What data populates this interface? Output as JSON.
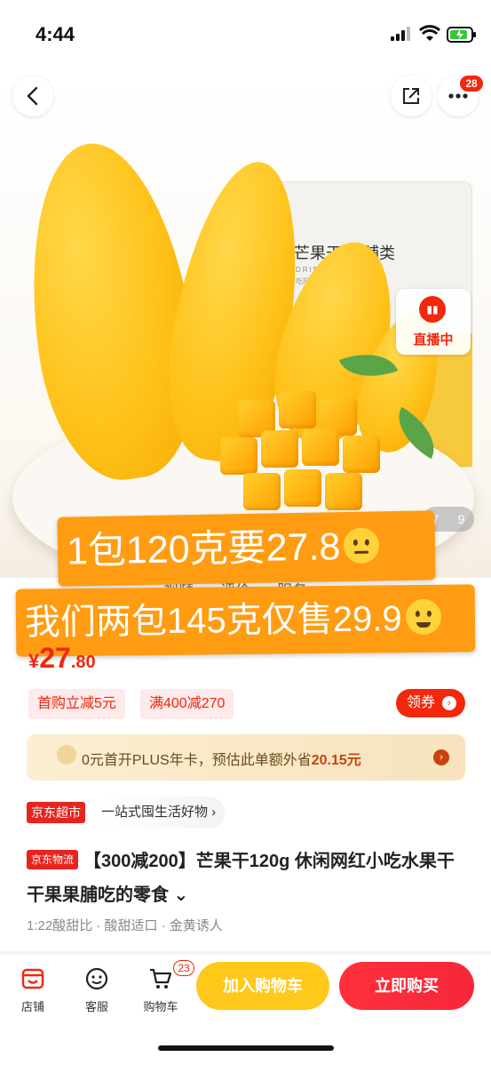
{
  "status_bar": {
    "time": "4:44"
  },
  "header": {
    "more_badge": "28"
  },
  "hero": {
    "package_title": "芒果干(果脯类",
    "package_sub": "DRIED MANGO",
    "package_line": "吃阳光长大的芒果干",
    "live_label": "直播中",
    "page_current": "7",
    "page_total": "9"
  },
  "overlay": {
    "line1": "1包120克要27.8",
    "line2": "我们两包145克仅售29.9"
  },
  "tabs": [
    "视频",
    "评价",
    "服务"
  ],
  "price": {
    "symbol": "¥",
    "integer": "27",
    "decimal": ".80"
  },
  "promo_tags": {
    "first": "首购立减5元",
    "second": "满400减270"
  },
  "coupon_button": "领券",
  "plus": {
    "prefix": "0元首开PLUS年卡，预估此单额外省",
    "amount": "20.15元"
  },
  "store": {
    "tag": "京东超市",
    "slogan": "一站式囤生活好物 ›"
  },
  "product": {
    "logistics_tag": "京东物流",
    "title": "【300减200】芒果干120g 休闲网红小吃水果干 干果果脯吃的零食 ⌄"
  },
  "traits": "1:22酸甜比 · 酸甜适口 · 金黄诱人",
  "bottom_bar": {
    "store": "店铺",
    "service": "客服",
    "cart": "购物车",
    "cart_count": "23",
    "add_to_cart": "加入购物车",
    "buy_now": "立即购买"
  },
  "colors": {
    "accent": "#f2270c",
    "orange": "#ff9c12",
    "yellow_button": "#ffc81a"
  }
}
